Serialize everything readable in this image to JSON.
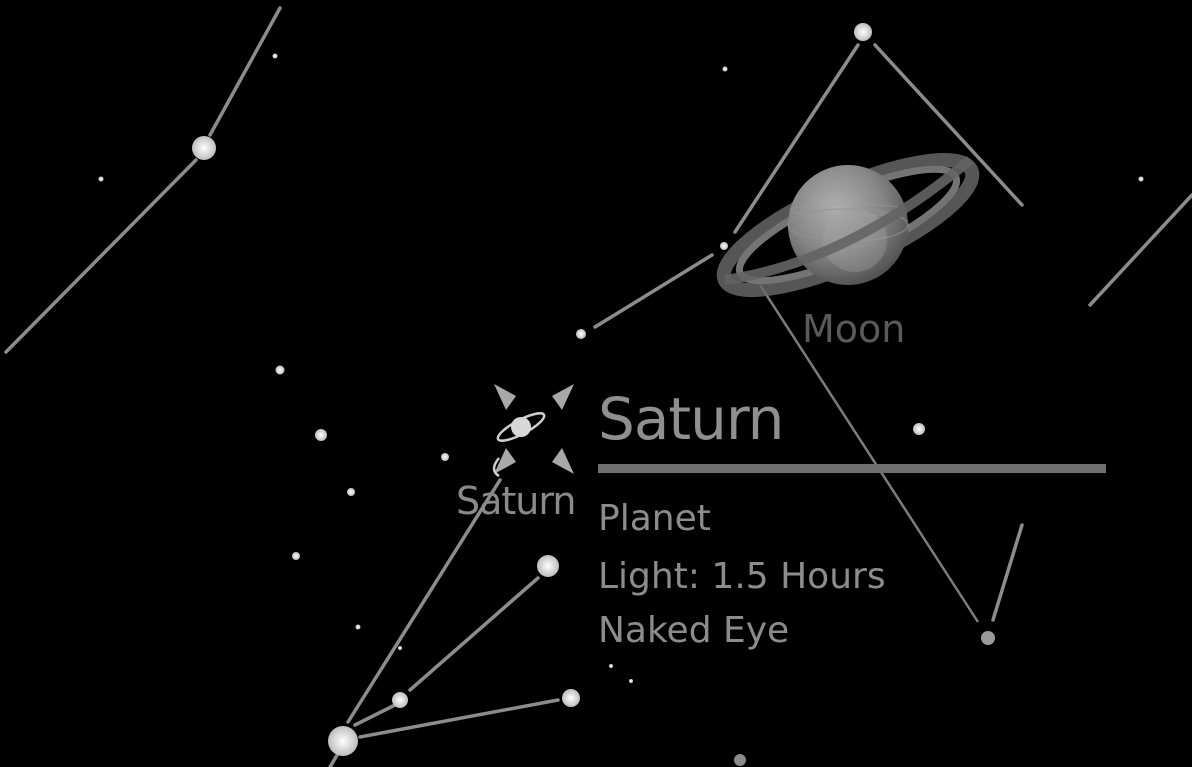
{
  "selected_object": {
    "name": "Saturn",
    "type": "Planet",
    "light_travel": "Light: 1.5 Hours",
    "visibility": "Naked Eye"
  },
  "sky_labels": {
    "planet": "Saturn",
    "moon": "Moon"
  },
  "icons": {
    "selection_reticle": "crosshair-reticle-icon",
    "planet_glyph": "saturn-icon",
    "moon_body": "saturn-planet-image"
  },
  "colors": {
    "background": "#000000",
    "constellation_line": "#8c8c8c",
    "star": "#d0d0d0",
    "info_text": "#8f8f8f",
    "info_rule": "#6e6e6e",
    "reticle": "#a8a8a8"
  }
}
